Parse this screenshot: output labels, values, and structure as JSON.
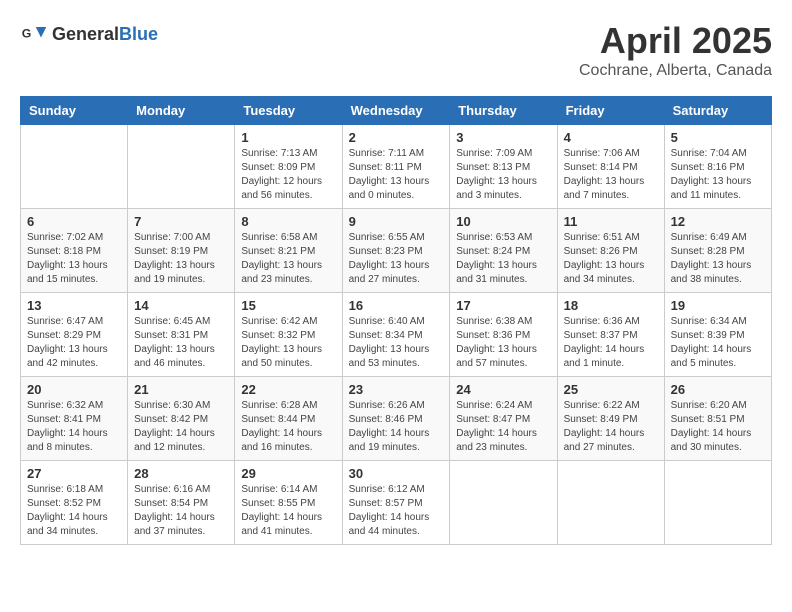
{
  "header": {
    "logo_general": "General",
    "logo_blue": "Blue",
    "month": "April 2025",
    "location": "Cochrane, Alberta, Canada"
  },
  "days_of_week": [
    "Sunday",
    "Monday",
    "Tuesday",
    "Wednesday",
    "Thursday",
    "Friday",
    "Saturday"
  ],
  "weeks": [
    [
      {
        "day": "",
        "info": ""
      },
      {
        "day": "",
        "info": ""
      },
      {
        "day": "1",
        "info": "Sunrise: 7:13 AM\nSunset: 8:09 PM\nDaylight: 12 hours\nand 56 minutes."
      },
      {
        "day": "2",
        "info": "Sunrise: 7:11 AM\nSunset: 8:11 PM\nDaylight: 13 hours\nand 0 minutes."
      },
      {
        "day": "3",
        "info": "Sunrise: 7:09 AM\nSunset: 8:13 PM\nDaylight: 13 hours\nand 3 minutes."
      },
      {
        "day": "4",
        "info": "Sunrise: 7:06 AM\nSunset: 8:14 PM\nDaylight: 13 hours\nand 7 minutes."
      },
      {
        "day": "5",
        "info": "Sunrise: 7:04 AM\nSunset: 8:16 PM\nDaylight: 13 hours\nand 11 minutes."
      }
    ],
    [
      {
        "day": "6",
        "info": "Sunrise: 7:02 AM\nSunset: 8:18 PM\nDaylight: 13 hours\nand 15 minutes."
      },
      {
        "day": "7",
        "info": "Sunrise: 7:00 AM\nSunset: 8:19 PM\nDaylight: 13 hours\nand 19 minutes."
      },
      {
        "day": "8",
        "info": "Sunrise: 6:58 AM\nSunset: 8:21 PM\nDaylight: 13 hours\nand 23 minutes."
      },
      {
        "day": "9",
        "info": "Sunrise: 6:55 AM\nSunset: 8:23 PM\nDaylight: 13 hours\nand 27 minutes."
      },
      {
        "day": "10",
        "info": "Sunrise: 6:53 AM\nSunset: 8:24 PM\nDaylight: 13 hours\nand 31 minutes."
      },
      {
        "day": "11",
        "info": "Sunrise: 6:51 AM\nSunset: 8:26 PM\nDaylight: 13 hours\nand 34 minutes."
      },
      {
        "day": "12",
        "info": "Sunrise: 6:49 AM\nSunset: 8:28 PM\nDaylight: 13 hours\nand 38 minutes."
      }
    ],
    [
      {
        "day": "13",
        "info": "Sunrise: 6:47 AM\nSunset: 8:29 PM\nDaylight: 13 hours\nand 42 minutes."
      },
      {
        "day": "14",
        "info": "Sunrise: 6:45 AM\nSunset: 8:31 PM\nDaylight: 13 hours\nand 46 minutes."
      },
      {
        "day": "15",
        "info": "Sunrise: 6:42 AM\nSunset: 8:32 PM\nDaylight: 13 hours\nand 50 minutes."
      },
      {
        "day": "16",
        "info": "Sunrise: 6:40 AM\nSunset: 8:34 PM\nDaylight: 13 hours\nand 53 minutes."
      },
      {
        "day": "17",
        "info": "Sunrise: 6:38 AM\nSunset: 8:36 PM\nDaylight: 13 hours\nand 57 minutes."
      },
      {
        "day": "18",
        "info": "Sunrise: 6:36 AM\nSunset: 8:37 PM\nDaylight: 14 hours\nand 1 minute."
      },
      {
        "day": "19",
        "info": "Sunrise: 6:34 AM\nSunset: 8:39 PM\nDaylight: 14 hours\nand 5 minutes."
      }
    ],
    [
      {
        "day": "20",
        "info": "Sunrise: 6:32 AM\nSunset: 8:41 PM\nDaylight: 14 hours\nand 8 minutes."
      },
      {
        "day": "21",
        "info": "Sunrise: 6:30 AM\nSunset: 8:42 PM\nDaylight: 14 hours\nand 12 minutes."
      },
      {
        "day": "22",
        "info": "Sunrise: 6:28 AM\nSunset: 8:44 PM\nDaylight: 14 hours\nand 16 minutes."
      },
      {
        "day": "23",
        "info": "Sunrise: 6:26 AM\nSunset: 8:46 PM\nDaylight: 14 hours\nand 19 minutes."
      },
      {
        "day": "24",
        "info": "Sunrise: 6:24 AM\nSunset: 8:47 PM\nDaylight: 14 hours\nand 23 minutes."
      },
      {
        "day": "25",
        "info": "Sunrise: 6:22 AM\nSunset: 8:49 PM\nDaylight: 14 hours\nand 27 minutes."
      },
      {
        "day": "26",
        "info": "Sunrise: 6:20 AM\nSunset: 8:51 PM\nDaylight: 14 hours\nand 30 minutes."
      }
    ],
    [
      {
        "day": "27",
        "info": "Sunrise: 6:18 AM\nSunset: 8:52 PM\nDaylight: 14 hours\nand 34 minutes."
      },
      {
        "day": "28",
        "info": "Sunrise: 6:16 AM\nSunset: 8:54 PM\nDaylight: 14 hours\nand 37 minutes."
      },
      {
        "day": "29",
        "info": "Sunrise: 6:14 AM\nSunset: 8:55 PM\nDaylight: 14 hours\nand 41 minutes."
      },
      {
        "day": "30",
        "info": "Sunrise: 6:12 AM\nSunset: 8:57 PM\nDaylight: 14 hours\nand 44 minutes."
      },
      {
        "day": "",
        "info": ""
      },
      {
        "day": "",
        "info": ""
      },
      {
        "day": "",
        "info": ""
      }
    ]
  ]
}
